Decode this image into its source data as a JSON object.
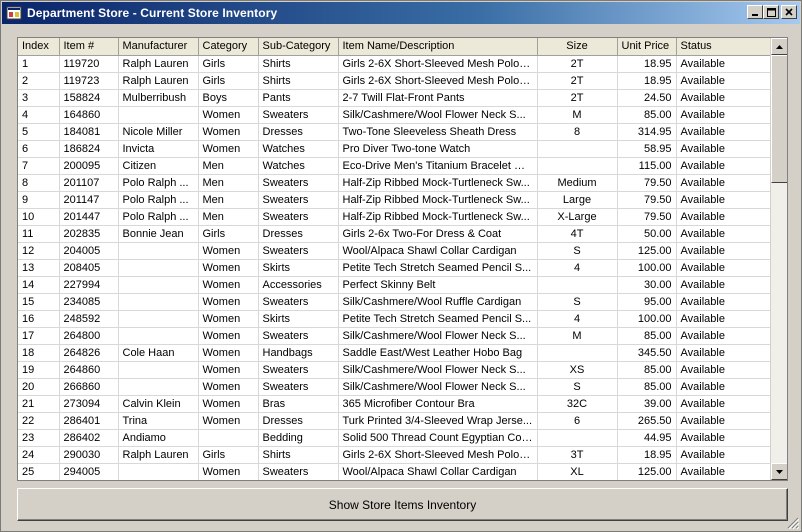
{
  "window": {
    "title": "Department Store - Current Store Inventory"
  },
  "grid": {
    "columns": [
      "Index",
      "Item #",
      "Manufacturer",
      "Category",
      "Sub-Category",
      "Item Name/Description",
      "Size",
      "Unit Price",
      "Status"
    ],
    "rows": [
      [
        "1",
        "119720",
        "Ralph Lauren",
        "Girls",
        "Shirts",
        "Girls 2-6X Short-Sleeved Mesh Polo S...",
        "2T",
        "18.95",
        "Available"
      ],
      [
        "2",
        "119723",
        "Ralph Lauren",
        "Girls",
        "Shirts",
        "Girls 2-6X Short-Sleeved Mesh Polo S...",
        "2T",
        "18.95",
        "Available"
      ],
      [
        "3",
        "158824",
        "Mulberribush",
        "Boys",
        "Pants",
        "2-7 Twill Flat-Front Pants",
        "2T",
        "24.50",
        "Available"
      ],
      [
        "4",
        "164860",
        "",
        "Women",
        "Sweaters",
        "Silk/Cashmere/Wool Flower Neck S...",
        "M",
        "85.00",
        "Available"
      ],
      [
        "5",
        "184081",
        "Nicole Miller",
        "Women",
        "Dresses",
        "Two-Tone Sleeveless Sheath Dress",
        "8",
        "314.95",
        "Available"
      ],
      [
        "6",
        "186824",
        "Invicta",
        "Women",
        "Watches",
        "Pro Diver Two-tone Watch",
        "",
        "58.95",
        "Available"
      ],
      [
        "7",
        "200095",
        "Citizen",
        "Men",
        "Watches",
        "Eco-Drive Men's Titanium Bracelet W...",
        "",
        "115.00",
        "Available"
      ],
      [
        "8",
        "201107",
        "Polo Ralph ...",
        "Men",
        "Sweaters",
        "Half-Zip Ribbed Mock-Turtleneck Sw...",
        "Medium",
        "79.50",
        "Available"
      ],
      [
        "9",
        "201147",
        "Polo Ralph ...",
        "Men",
        "Sweaters",
        "Half-Zip Ribbed Mock-Turtleneck Sw...",
        "Large",
        "79.50",
        "Available"
      ],
      [
        "10",
        "201447",
        "Polo Ralph ...",
        "Men",
        "Sweaters",
        "Half-Zip Ribbed Mock-Turtleneck Sw...",
        "X-Large",
        "79.50",
        "Available"
      ],
      [
        "11",
        "202835",
        "Bonnie Jean",
        "Girls",
        "Dresses",
        "Girls 2-6x Two-For Dress & Coat",
        "4T",
        "50.00",
        "Available"
      ],
      [
        "12",
        "204005",
        "",
        "Women",
        "Sweaters",
        "Wool/Alpaca Shawl Collar Cardigan",
        "S",
        "125.00",
        "Available"
      ],
      [
        "13",
        "208405",
        "",
        "Women",
        "Skirts",
        "Petite Tech Stretch Seamed Pencil S...",
        "4",
        "100.00",
        "Available"
      ],
      [
        "14",
        "227994",
        "",
        "Women",
        "Accessories",
        "Perfect Skinny Belt",
        "",
        "30.00",
        "Available"
      ],
      [
        "15",
        "234085",
        "",
        "Women",
        "Sweaters",
        "Silk/Cashmere/Wool Ruffle Cardigan",
        "S",
        "95.00",
        "Available"
      ],
      [
        "16",
        "248592",
        "",
        "Women",
        "Skirts",
        "Petite Tech Stretch Seamed Pencil S...",
        "4",
        "100.00",
        "Available"
      ],
      [
        "17",
        "264800",
        "",
        "Women",
        "Sweaters",
        "Silk/Cashmere/Wool Flower Neck S...",
        "M",
        "85.00",
        "Available"
      ],
      [
        "18",
        "264826",
        "Cole Haan",
        "Women",
        "Handbags",
        "Saddle East/West Leather Hobo Bag",
        "",
        "345.50",
        "Available"
      ],
      [
        "19",
        "264860",
        "",
        "Women",
        "Sweaters",
        "Silk/Cashmere/Wool Flower Neck S...",
        "XS",
        "85.00",
        "Available"
      ],
      [
        "20",
        "266860",
        "",
        "Women",
        "Sweaters",
        "Silk/Cashmere/Wool Flower Neck S...",
        "S",
        "85.00",
        "Available"
      ],
      [
        "21",
        "273094",
        "Calvin Klein",
        "Women",
        "Bras",
        "365 Microfiber Contour Bra",
        "32C",
        "39.00",
        "Available"
      ],
      [
        "22",
        "286401",
        "Trina",
        "Women",
        "Dresses",
        "Turk Printed 3/4-Sleeved Wrap Jerse...",
        "6",
        "265.50",
        "Available"
      ],
      [
        "23",
        "286402",
        "Andiamo",
        "",
        "Bedding",
        "Solid 500 Thread Count Egyptian Cott...",
        "",
        "44.95",
        "Available"
      ],
      [
        "24",
        "290030",
        "Ralph Lauren",
        "Girls",
        "Shirts",
        "Girls 2-6X Short-Sleeved Mesh Polo S...",
        "3T",
        "18.95",
        "Available"
      ],
      [
        "25",
        "294005",
        "",
        "Women",
        "Sweaters",
        "Wool/Alpaca Shawl Collar Cardigan",
        "XL",
        "125.00",
        "Available"
      ]
    ]
  },
  "actions": {
    "show_button_label": "Show Store Items Inventory"
  }
}
